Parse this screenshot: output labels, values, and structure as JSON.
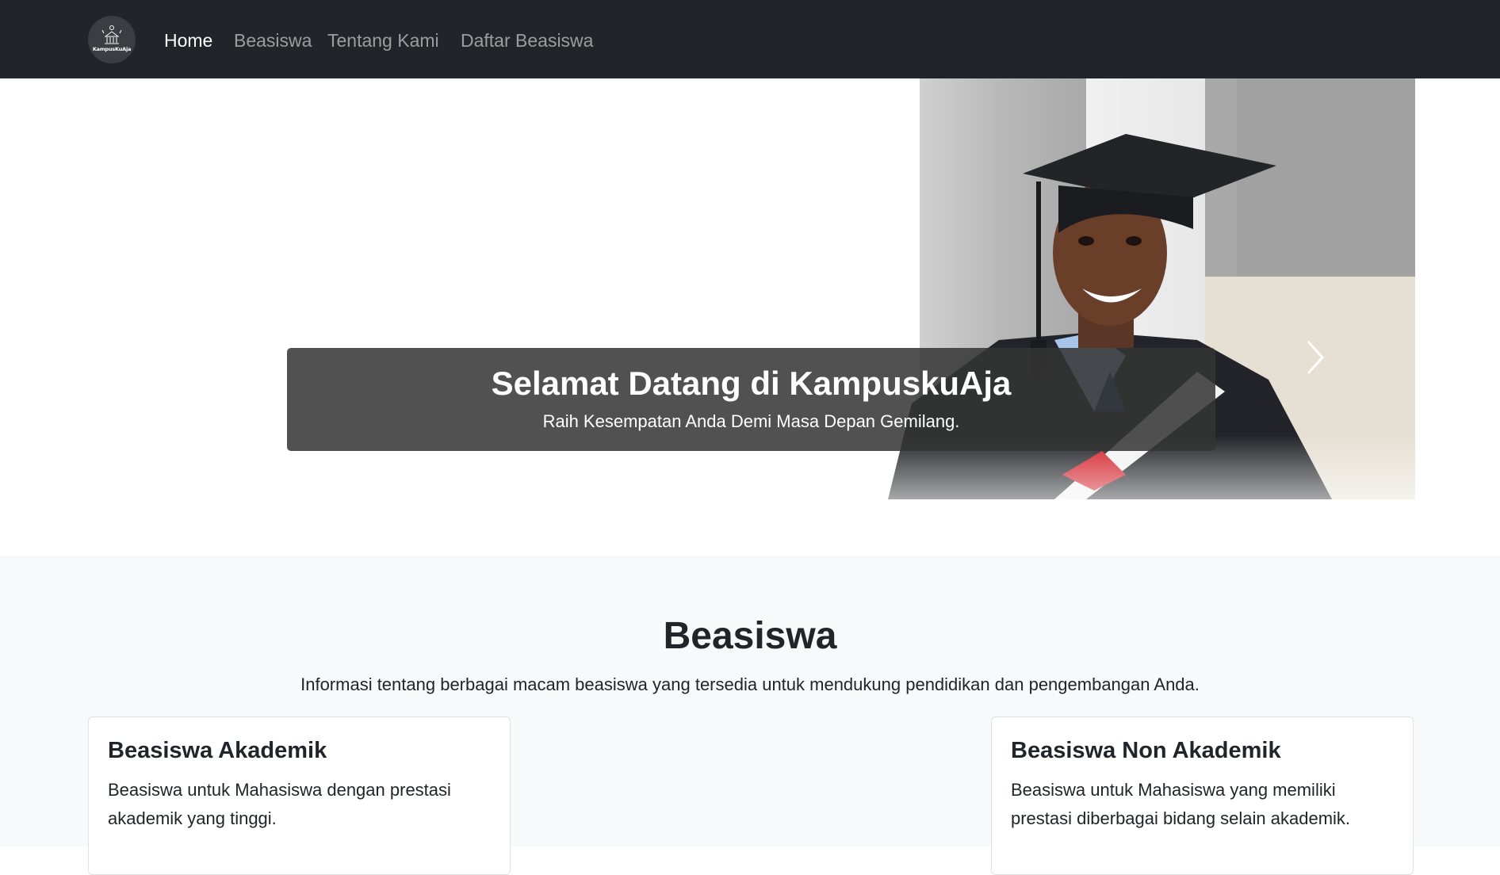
{
  "brand": {
    "logo_text": "KampusKuAja"
  },
  "nav": {
    "items": [
      {
        "label": "Home",
        "active": true
      },
      {
        "label": "Beasiswa",
        "active": false
      },
      {
        "label": "Tentang Kami",
        "active": false
      },
      {
        "label": "Daftar Beasiswa",
        "active": false
      }
    ]
  },
  "hero": {
    "title": "Selamat Datang di KampuskuAja",
    "subtitle": "Raih Kesempatan Anda Demi Masa Depan Gemilang.",
    "next_icon": "chevron-right-icon"
  },
  "section": {
    "title": "Beasiswa",
    "lead": "Informasi tentang berbagai macam beasiswa yang tersedia untuk mendukung pendidikan dan pengembangan Anda.",
    "cards": [
      {
        "title": "Beasiswa Akademik",
        "text": "Beasiswa untuk Mahasiswa dengan prestasi akademik yang tinggi."
      },
      {
        "title": "Beasiswa Non Akademik",
        "text": "Beasiswa untuk Mahasiswa yang memiliki prestasi diberbagai bidang selain akademik."
      }
    ]
  },
  "colors": {
    "navbar_bg": "#212529",
    "caption_bg": "#343434",
    "section_bg": "#f8f9fa"
  }
}
